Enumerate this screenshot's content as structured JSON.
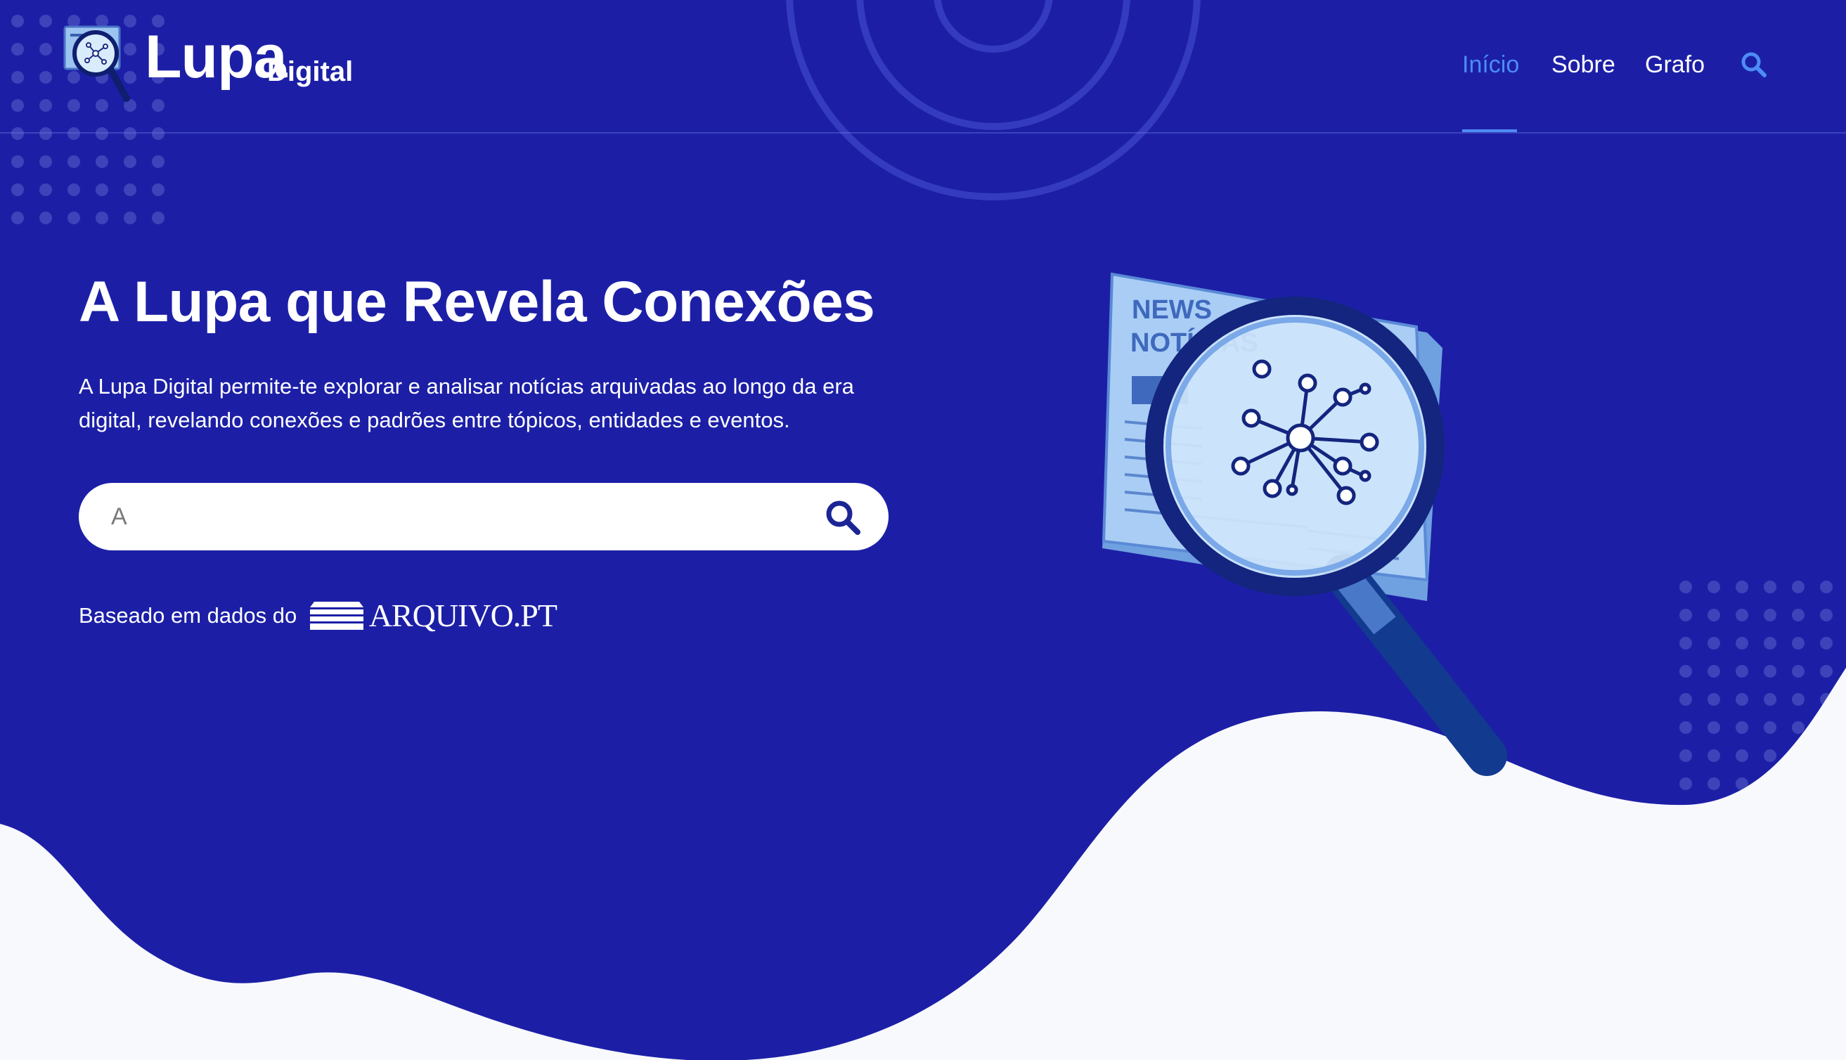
{
  "brand": {
    "name_main": "Lupa",
    "name_sub": "Digital"
  },
  "nav": {
    "items": [
      {
        "label": "Início",
        "active": true
      },
      {
        "label": "Sobre",
        "active": false
      },
      {
        "label": "Grafo",
        "active": false
      }
    ],
    "search_icon": "search-icon"
  },
  "hero": {
    "title": "A Lupa que Revela Conexões",
    "description": "A Lupa Digital permite-te explorar e analisar notícias arquivadas ao longo da era digital, revelando conexões e padrões entre tópicos, entidades e eventos.",
    "search": {
      "value": "A",
      "placeholder": "",
      "button_icon": "search-icon"
    },
    "based_on_text": "Baseado em dados do",
    "source_logo_text": "ARQUIVO.PT"
  },
  "illustration": {
    "newspaper_text_1": "NEWS",
    "newspaper_text_2": "NOTÍCIAS",
    "icon": "magnifier-newspaper-network-icon"
  },
  "colors": {
    "background": "#1c1fa6",
    "accent": "#4d8bf5",
    "wave": "#f8f9fc",
    "text": "#ffffff"
  }
}
